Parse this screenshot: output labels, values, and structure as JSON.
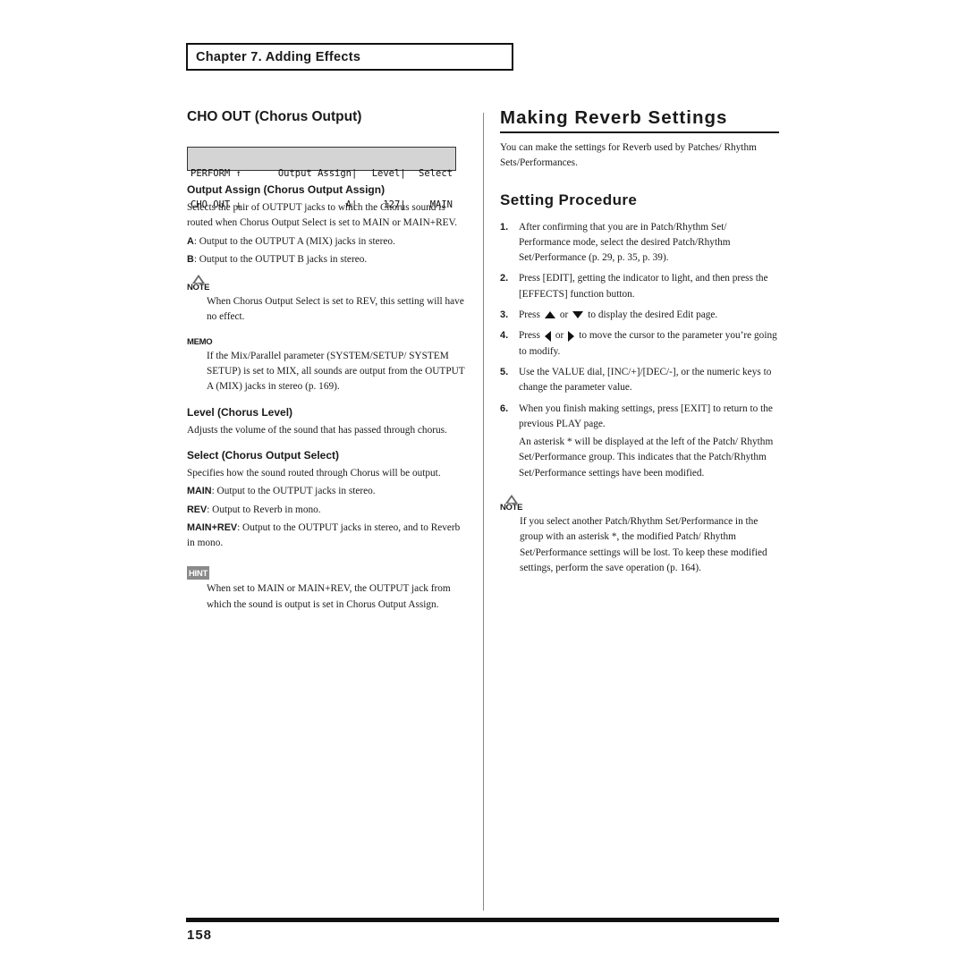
{
  "header": {
    "chapter": "Chapter 7. Adding Effects"
  },
  "left": {
    "title": "CHO OUT (Chorus Output)",
    "lcd": {
      "row1": [
        "PERFORM ↑",
        "Output Assign|",
        "Level|",
        "Select"
      ],
      "row2": [
        "CHO OUT ↓",
        "A|",
        "127|",
        "MAIN"
      ]
    },
    "output_assign": {
      "heading": "Output Assign (Chorus Output Assign)",
      "desc": "Selects the pair of OUTPUT jacks to which the Chorus sound is routed when Chorus Output Select is set to MAIN or MAIN+REV.",
      "options": [
        {
          "key": "A",
          "text": ": Output to the OUTPUT A (MIX) jacks in stereo."
        },
        {
          "key": "B",
          "text": ": Output to the OUTPUT B jacks in stereo."
        }
      ]
    },
    "note": {
      "label": "NOTE",
      "text": "When Chorus Output Select is set to REV, this setting will have no effect."
    },
    "memo": {
      "label": "MEMO",
      "text": "If the Mix/Parallel parameter (SYSTEM/SETUP/ SYSTEM SETUP) is set to MIX, all sounds are output from the OUTPUT A (MIX) jacks in stereo (p. 169)."
    },
    "level": {
      "heading": "Level (Chorus Level)",
      "desc": "Adjusts the volume of the sound that has passed through chorus."
    },
    "select": {
      "heading": "Select (Chorus Output Select)",
      "desc": "Specifies how the sound routed through Chorus will be output.",
      "options": [
        {
          "key": "MAIN",
          "text": ": Output to the OUTPUT jacks in stereo."
        },
        {
          "key": "REV",
          "text": ": Output to Reverb in mono."
        },
        {
          "key": "MAIN+REV",
          "text": ": Output to the OUTPUT jacks in stereo, and to Reverb in mono."
        }
      ]
    },
    "hint": {
      "label": "HINT",
      "text": "When set to MAIN or MAIN+REV, the OUTPUT jack from which the sound is output is set in Chorus Output Assign."
    }
  },
  "right": {
    "title": "Making Reverb Settings",
    "intro": "You can make the settings for Reverb used by Patches/ Rhythm Sets/Performances.",
    "procedure_title": "Setting Procedure",
    "steps": [
      {
        "num": "1.",
        "text": "After confirming that you are in Patch/Rhythm Set/ Performance mode, select the desired Patch/Rhythm Set/Performance (p. 29, p. 35, p. 39)."
      },
      {
        "num": "2.",
        "text": "Press [EDIT], getting the indicator to light, and then press the [EFFECTS] function button."
      },
      {
        "num": "3.",
        "pre": "Press",
        "mid": "or",
        "post": "to display the desired Edit page."
      },
      {
        "num": "4.",
        "pre": "Press",
        "mid": "or",
        "post": "to move the cursor to the parameter you’re going to modify."
      },
      {
        "num": "5.",
        "text": "Use the VALUE dial, [INC/+]/[DEC/-], or the numeric keys to change the parameter value."
      },
      {
        "num": "6.",
        "text": "When you finish making settings, press [EXIT] to return to the previous PLAY page.",
        "extra": "An asterisk * will be displayed at the left of the Patch/ Rhythm Set/Performance group. This indicates that the Patch/Rhythm Set/Performance settings have been modified."
      }
    ],
    "note": {
      "label": "NOTE",
      "text": "If you select another Patch/Rhythm Set/Performance in the group with an asterisk *, the modified Patch/ Rhythm Set/Performance settings will be lost. To keep these modified settings, perform the save operation (p. 164)."
    }
  },
  "footer": {
    "page_number": "158"
  }
}
